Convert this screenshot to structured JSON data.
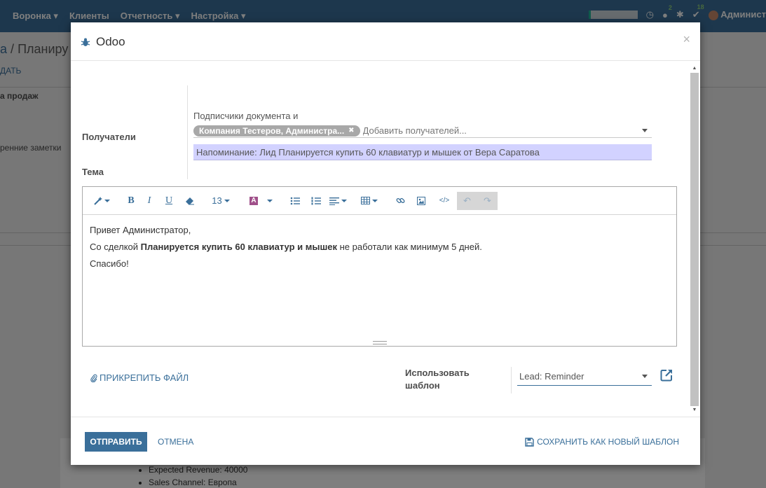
{
  "app": {
    "menu": [
      "Воронка",
      "Клиенты",
      "Отчетность",
      "Настройка"
    ],
    "user_name": "Админист",
    "chat_count": "2",
    "activity_count": "18",
    "breadcrumb_root": "а",
    "breadcrumb_sep": "/",
    "breadcrumb_current": "Планиру",
    "create_label": "ДАТЬ",
    "pipeline_label": "а продаж",
    "notes_label": "ренние заметки",
    "list_items": [
      "Expected Revenue: 40000",
      "Sales Channel: Европа"
    ]
  },
  "dialog": {
    "title": "Odoo",
    "close_label": "×",
    "recipients_label": "Получатели",
    "recipients_hint": "Подписчики документа и",
    "recipient_tag": "Компания Тестеров, Администра...",
    "recipients_placeholder": "Добавить получателей...",
    "subject_label": "Тема",
    "subject_value": "Напоминание: Лид Планируется купить 60 клавиатур и мышек от Вера Саратова",
    "toolbar": {
      "font_size": "13"
    },
    "body": {
      "greeting": "Привет Администратор,",
      "line2_prefix": "Со сделкой ",
      "line2_bold": "Планируется купить 60 клавиатур и мышек",
      "line2_suffix": " не работали как минимум 5 дней.",
      "closing": "Спасибо!"
    },
    "attach_label": "ПРИКРЕПИТЬ ФАЙЛ",
    "template_label_1": "Использовать",
    "template_label_2": "шаблон",
    "template_value": "Lead: Reminder",
    "send_label": "ОТПРАВИТЬ",
    "cancel_label": "ОТМЕНА",
    "save_template_label": "СОХРАНИТЬ КАК НОВЫЙ ШАБЛОН"
  },
  "colors": {
    "primary": "#3a6f9a",
    "subject_bg": "#d2d2ff",
    "tag_bg": "#a8a8a8"
  }
}
